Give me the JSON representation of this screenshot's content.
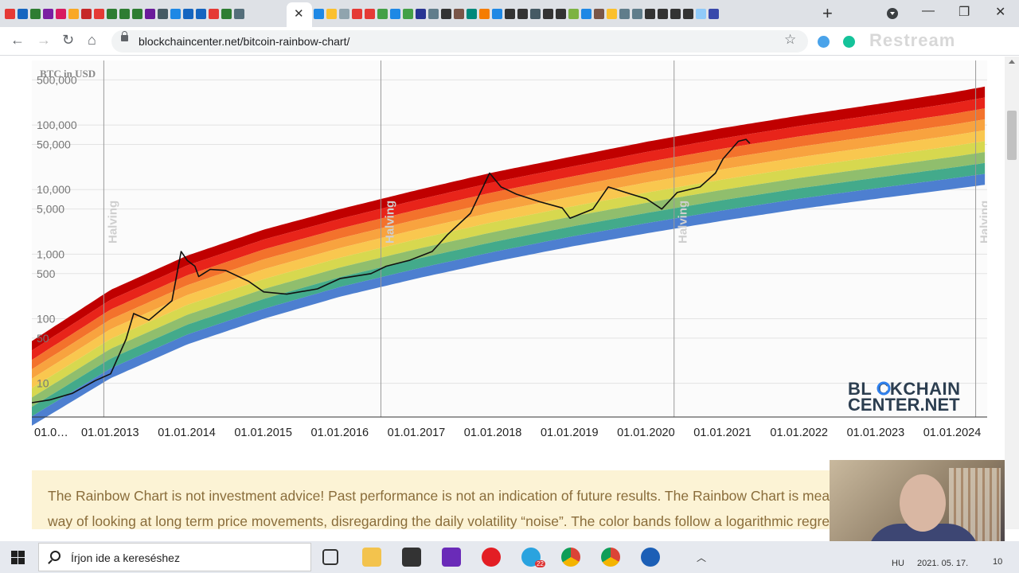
{
  "browser": {
    "url": "blockchaincenter.net/bitcoin-rainbow-chart/",
    "tab_close": "✕",
    "new_tab": "+",
    "restream_label": "Restream",
    "controls": {
      "minimize": "—",
      "restore": "❐",
      "close": "✕"
    },
    "nav": {
      "back": "←",
      "forward": "→",
      "reload": "↻",
      "home": "⌂",
      "bookmark": "☆"
    }
  },
  "chart_data": {
    "type": "area",
    "title": "",
    "ylabel": "BTC in USD",
    "y_scale": "log",
    "ylim": [
      3,
      1000000
    ],
    "y_ticks": [
      "500,000",
      "100,000",
      "50,000",
      "10,000",
      "5,000",
      "1,000",
      "500",
      "100",
      "50",
      "10"
    ],
    "y_tick_values": [
      500000,
      100000,
      50000,
      10000,
      5000,
      1000,
      500,
      100,
      50,
      10
    ],
    "x_tick_labels": [
      "01.0…",
      "01.01.2013",
      "01.01.2014",
      "01.01.2015",
      "01.01.2016",
      "01.01.2017",
      "01.01.2018",
      "01.01.2019",
      "01.01.2020",
      "01.01.2021",
      "01.01.2022",
      "01.01.2023",
      "01.01.2024"
    ],
    "x_tick_years": [
      2012.0,
      2013.0,
      2014.0,
      2015.0,
      2016.0,
      2017.0,
      2018.0,
      2019.0,
      2020.0,
      2021.0,
      2022.0,
      2023.0,
      2024.0
    ],
    "xlim": [
      2011.97,
      2024.45
    ],
    "halvings": [
      {
        "label": "Halving",
        "year": 2012.91
      },
      {
        "label": "Halving",
        "year": 2016.53
      },
      {
        "label": "Halving",
        "year": 2020.36
      },
      {
        "label": "Halving",
        "year": 2024.3
      }
    ],
    "band_colors": [
      "#c00000",
      "#e8241a",
      "#f3722c",
      "#f8a33f",
      "#f9c74f",
      "#d7d84f",
      "#90be6d",
      "#43aa8b",
      "#4d7fd0"
    ],
    "band_curves": {
      "x": [
        2011.97,
        2013.0,
        2014.0,
        2015.0,
        2016.0,
        2017.0,
        2018.0,
        2019.0,
        2020.0,
        2021.0,
        2022.0,
        2023.0,
        2024.0,
        2024.45
      ],
      "top": [
        45,
        280,
        950,
        2400,
        5000,
        9800,
        18500,
        32000,
        55000,
        90000,
        140000,
        210000,
        320000,
        400000
      ],
      "bottom": [
        2.2,
        12,
        40,
        100,
        220,
        420,
        760,
        1300,
        2100,
        3300,
        5000,
        7200,
        10200,
        12000
      ]
    },
    "price": {
      "name": "",
      "x": [
        2011.97,
        2012.2,
        2012.5,
        2012.8,
        2013.0,
        2013.2,
        2013.3,
        2013.5,
        2013.8,
        2013.92,
        2014.0,
        2014.1,
        2014.15,
        2014.3,
        2014.5,
        2014.8,
        2015.0,
        2015.3,
        2015.7,
        2016.0,
        2016.4,
        2016.6,
        2016.9,
        2017.2,
        2017.4,
        2017.7,
        2017.95,
        2018.1,
        2018.3,
        2018.6,
        2018.9,
        2019.0,
        2019.3,
        2019.5,
        2019.8,
        2020.0,
        2020.2,
        2020.4,
        2020.7,
        2020.9,
        2021.0,
        2021.2,
        2021.3,
        2021.35
      ],
      "y": [
        5,
        5.5,
        7,
        11,
        14,
        48,
        120,
        95,
        190,
        1100,
        800,
        650,
        450,
        580,
        560,
        380,
        260,
        240,
        290,
        420,
        500,
        650,
        800,
        1100,
        2000,
        4300,
        18000,
        11000,
        8500,
        6500,
        5200,
        3600,
        5000,
        11000,
        8500,
        7200,
        5000,
        9000,
        11000,
        18000,
        30000,
        56000,
        60000,
        52000
      ]
    }
  },
  "watermark": {
    "line1": "BL CKCHAIN",
    "line2": "CENTER.NET"
  },
  "notice": {
    "line1": "The Rainbow Chart is not investment advice! Past performance is not an indication of future results. The Rainbow Chart is meant to be a fun",
    "line2": "way of looking at long term price movements, disregarding the daily volatility “noise”. The color bands follow a logarithmic regression"
  },
  "taskbar": {
    "search_placeholder": "Írjon ide a kereséshez",
    "language": "HU",
    "date": "2021. 05. 17.",
    "telegram_badge": "22",
    "time_partial": "10"
  }
}
